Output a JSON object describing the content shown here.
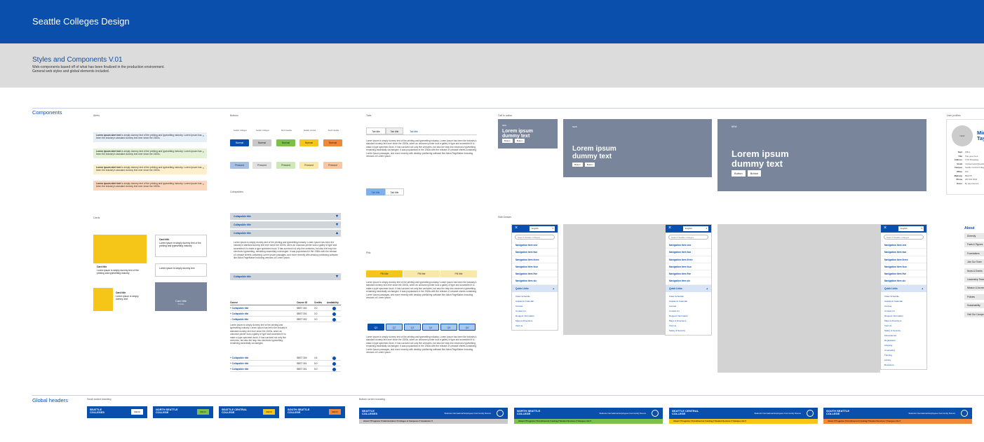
{
  "header": {
    "title": "Seattle Colleges Design"
  },
  "intro": {
    "title": "Styles and Components V.01",
    "lines": [
      "Web-components based off of what has been finalized in the production environment.",
      "General web styles and global elements included."
    ]
  },
  "sections": {
    "components": "Components",
    "global_headers": "Global headers"
  },
  "labels": {
    "alerts": "Alerts",
    "buttons": "Buttons",
    "tabs": "Tabs",
    "call_to_action": "Call to action",
    "user_profiles": "User profiles",
    "cards": "Cards",
    "collapsibles": "Collapsibles",
    "pills": "Pills",
    "side_drawer": "Side Drawer",
    "small_branding": "Small scaled branding",
    "bottom_branding": "Bottom screen branding"
  },
  "alerts": [
    {
      "bold": "Lorem ipsum alert text",
      "text": "is simply dummy text of the printing and typesetting industry. Lorem Ipsum has been the industry's standard dummy text ever since the 1500s.",
      "bg": "#e6eef8"
    },
    {
      "bold": "Lorem ipsum alert text",
      "text": "is simply dummy text of the printing and typesetting industry. Lorem Ipsum has been the industry's standard dummy text ever since the 1500s.",
      "bg": "#e3f1d6"
    },
    {
      "bold": "Lorem ipsum alert text",
      "text": "is simply dummy text of the printing and typesetting industry. Lorem Ipsum has been the industry's standard dummy text ever since the 1500s.",
      "bg": "#fbefcc"
    },
    {
      "bold": "Lorem ipsum alert text",
      "text": "is simply dummy text of the printing and typesetting industry. Lorem Ipsum has been the industry's standard dummy text ever since the 1500s.",
      "bg": "#fbd8bd"
    }
  ],
  "buttons": {
    "columns": [
      "Seattle Colleges",
      "Seattle Colleges",
      "North Seattle",
      "Seattle Central",
      "South Seattle"
    ],
    "normal_label": "Normal",
    "pressed_label": "Pressed",
    "normal_colors": [
      "#0b4fad",
      "#c8c8c8",
      "#7cbf4a",
      "#f5c518",
      "#f0883a"
    ],
    "pressed_colors": [
      "#a8c0e4",
      "#e0e0e0",
      "#cfe8b8",
      "#fae8a6",
      "#f8c7a0"
    ]
  },
  "tabs": {
    "top": [
      "Tab title",
      "Tab title",
      "Tab title"
    ],
    "body": "Lorem ipsum is simply dummy text of the printing and typesetting industry. Lorem Ipsum has been the industry's standard dummy text ever since the 1500s, when an unknown printer took a galley of type and scrambled it to make a type specimen book. It has survived not only five centuries, but also the leap into electronic typesetting, remaining essentially unchanged. It was popularised in the 1960s with the release of Letraset sheets containing Lorem Ipsum passages, and more recently with desktop publishing software like Aldus PageMaker including versions of Lorem Ipsum.",
    "bottom": [
      "Tab title",
      "Tab title"
    ]
  },
  "pills": {
    "top": [
      "Pill title",
      "Pill title",
      "Pill title"
    ],
    "numbered": [
      "Q1",
      "Q2",
      "Q3",
      "Q4",
      "Q5",
      "Q6"
    ]
  },
  "cta": {
    "small_tag": "NEW",
    "heading_l1": "Lorem ipsum",
    "heading_l2": "dummy text",
    "button": "Button"
  },
  "profile": {
    "avatar": "NEW",
    "name_l1": "Mic",
    "name_l2": "Tay",
    "rows": [
      [
        "Dept",
        "Office"
      ],
      [
        "Title",
        "Title goes here"
      ],
      [
        "Address",
        "1701 Broadway"
      ],
      [
        "Email",
        "michael.taylor@seattlecolleges.edu"
      ],
      [
        "Campus",
        "Seattle Central College"
      ],
      [
        "Office",
        "N/A"
      ],
      [
        "Mailstop",
        "BE2170"
      ],
      [
        "Phone",
        "206 934 4040"
      ],
      [
        "Hours",
        "By appointment"
      ]
    ]
  },
  "cards": {
    "title": "Card title",
    "text": "Lorem ipsum is simply dummy text of the printing and typesetting industry",
    "short": "Lorem ipsum is simply dummy text",
    "overlay_title": "Card title",
    "overlay_sub": "Subtitle"
  },
  "collapsibles": {
    "title": "Collapsible title",
    "body": "Lorem ipsum is simply dummy text of the printing and typesetting industry. Lorem Ipsum has been the industry's standard dummy text ever since the 1500s, when an unknown printer took a galley of type and scrambled it to make a type specimen book. It has survived not only five centuries, but also the leap into electronic typesetting, remaining essentially unchanged. It was popularised in the 1960s with the release of Letraset sheets containing Lorem Ipsum passages, and more recently with desktop publishing software like Aldus PageMaker including versions of Lorem Ipsum."
  },
  "course_table": {
    "headers": [
      "Course",
      "Course ID",
      "Credits",
      "Availability"
    ],
    "rows": [
      [
        "+ Collapsible title",
        "SBST 301",
        "3.0"
      ],
      [
        "+ Collapsible title",
        "SBST 301",
        "3.0"
      ],
      [
        "– Collapsible title",
        "SBST 302",
        "3.0"
      ],
      [
        "+ Collapsible title",
        "SBST 304",
        "4.5"
      ],
      [
        "+ Collapsible title",
        "SBST 301",
        "5.0"
      ],
      [
        "+ Collapsible title",
        "SBST 301",
        "5.0"
      ]
    ],
    "expanded_text": "Lorem ipsum is simply dummy text of the printing and typesetting industry. Lorem Ipsum has been the industry's standard dummy text ever since the 1500s, when an unknown printer took a galley of type and scrambled it to make a type specimen book. It has survived not only five centuries, but also the leap into electronic typesetting, remaining essentially unchanged."
  },
  "drawer": {
    "lang": "English",
    "search": "Search Seattle Colleges",
    "items": [
      "Navigation item one",
      "Navigation item two",
      "Navigation item three",
      "Navigation item four",
      "Navigation item five",
      "Navigation item six"
    ],
    "quick": "Quick Links",
    "links_a": [
      "Class Schedule",
      "Academic Calendar",
      "Canvas",
      "Contact Us",
      "Request Information",
      "Maps & Directions",
      "Visit Us"
    ],
    "links_c": [
      "Class Schedule",
      "Academic Calendar",
      "Canvas",
      "Contact Us",
      "Request Information",
      "Maps & Directions",
      "Visit Us",
      "Safety & Security"
    ],
    "links_d": [
      "Class Schedule",
      "Academic Calendar",
      "Canvas",
      "Contact Us",
      "Request Information",
      "Maps & Directions",
      "Visit Us",
      "Safety & Security",
      "Financial Aid",
      "Registration",
      "Advising",
      "Counseling",
      "Tutoring",
      "Library",
      "Bookstore"
    ]
  },
  "about": {
    "title": "About",
    "items": [
      "Diversity",
      "Facts & Figures",
      "Foundations",
      "Join Our Team",
      "News & Events",
      "Leadership Team",
      "Mission & Accreditation",
      "Policies",
      "Sustainability",
      "Visit Our Campus"
    ]
  },
  "global_small": [
    {
      "logo_l1": "SEATTLE",
      "logo_l2": "COLLEGES",
      "menu": "MENU",
      "accent": "#ffffff"
    },
    {
      "logo_l1": "NORTH SEATTLE",
      "logo_l2": "COLLEGE",
      "menu": "MENU",
      "accent": "#7cbf4a"
    },
    {
      "logo_l1": "SEATTLE CENTRAL",
      "logo_l2": "COLLEGE",
      "menu": "MENU",
      "accent": "#f5c518"
    },
    {
      "logo_l1": "SOUTH SEATTLE",
      "logo_l2": "COLLEGE",
      "menu": "MENU",
      "accent": "#f0883a"
    }
  ],
  "global_wide": [
    {
      "logo_l1": "SEATTLE",
      "logo_l2": "COLLEGES",
      "links": "Students   International   Employees   Community   Donors",
      "bottom": "About ▾    Programs ▾    Administration ▾    Colleges & Campuses ▾    Academics ▾",
      "bg": "#c8c8c8"
    },
    {
      "logo_l1": "NORTH SEATTLE",
      "logo_l2": "COLLEGE",
      "links": "Students   International   Employees   Community   Donors",
      "bottom": "About ▾    Programs ▾    Enrollment & Funding ▾    Student Services ▾    Campus Life ▾",
      "bg": "#7cbf4a"
    },
    {
      "logo_l1": "SEATTLE CENTRAL",
      "logo_l2": "COLLEGE",
      "links": "Students   International   Employees   Community   Donors",
      "bottom": "About ▾    Programs ▾    Enrollment & Funding ▾    Student Services ▾    Campus Life ▾",
      "bg": "#f5c518"
    },
    {
      "logo_l1": "SOUTH SEATTLE",
      "logo_l2": "COLLEGE",
      "links": "Students   International   Employees   Community   Donors",
      "bottom": "About ▾    Programs ▾    Enrollment & Funding ▾    Student Services ▾    Campus Life ▾",
      "bg": "#f0883a"
    }
  ]
}
